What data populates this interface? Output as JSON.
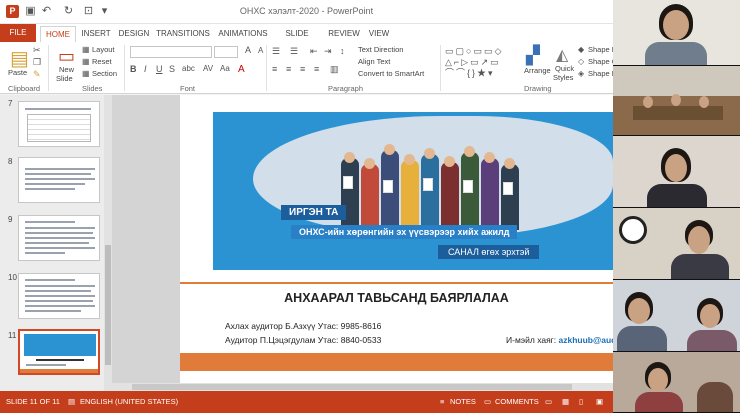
{
  "window": {
    "title": "ОНХС хэлэлт-2020 - PowerPoint"
  },
  "tabs": [
    {
      "label": "FILE"
    },
    {
      "label": "HOME"
    },
    {
      "label": "INSERT"
    },
    {
      "label": "DESIGN"
    },
    {
      "label": "TRANSITIONS"
    },
    {
      "label": "ANIMATIONS"
    },
    {
      "label": "SLIDE SHOW"
    },
    {
      "label": "REVIEW"
    },
    {
      "label": "VIEW"
    }
  ],
  "ribbon": {
    "clipboard": {
      "label": "Clipboard",
      "paste": "Paste"
    },
    "slides": {
      "label": "Slides",
      "new_slide_1": "New",
      "new_slide_2": "Slide",
      "layout": "Layout",
      "reset": "Reset",
      "section": "Section"
    },
    "font": {
      "label": "Font"
    },
    "paragraph": {
      "label": "Paragraph",
      "text_direction": "Text Direction",
      "align_text": "Align Text",
      "convert_smartart": "Convert to SmartArt"
    },
    "drawing": {
      "label": "Drawing",
      "arrange": "Arrange",
      "quick_styles_1": "Quick",
      "quick_styles_2": "Styles",
      "shape_fill": "Shape Fi",
      "shape_outline": "Shape O",
      "shape_effects": "Shape E"
    }
  },
  "thumbnails": [
    {
      "number": "7"
    },
    {
      "number": "8"
    },
    {
      "number": "9"
    },
    {
      "number": "10"
    },
    {
      "number": "11"
    }
  ],
  "slide": {
    "banner_line1": "ИРГЭН ТА",
    "banner_line2_bold": "ОНХС",
    "banner_line2_rest": "-ийн хөрөнгийн эх үүсвэрээр хийх ажилд",
    "banner_line3": "САНАЛ өгөх эрхтэй",
    "thanks": "АНХААРАЛ ТАВЬСАНД БАЯРЛАЛАА",
    "contact1": "Ахлах аудитор Б.Азхүү   Утас: 9985-8616",
    "contact2": "Аудитор П.Цэцэгдулам   Утас: 8840-0533",
    "email_label": "И-мэйл хаяг: ",
    "email_value": "azkhuub@aud"
  },
  "statusbar": {
    "slide_count": "SLIDE 11 OF 11",
    "language": "ENGLISH (UNITED STATES)",
    "notes": "NOTES",
    "comments": "COMMENTS"
  }
}
